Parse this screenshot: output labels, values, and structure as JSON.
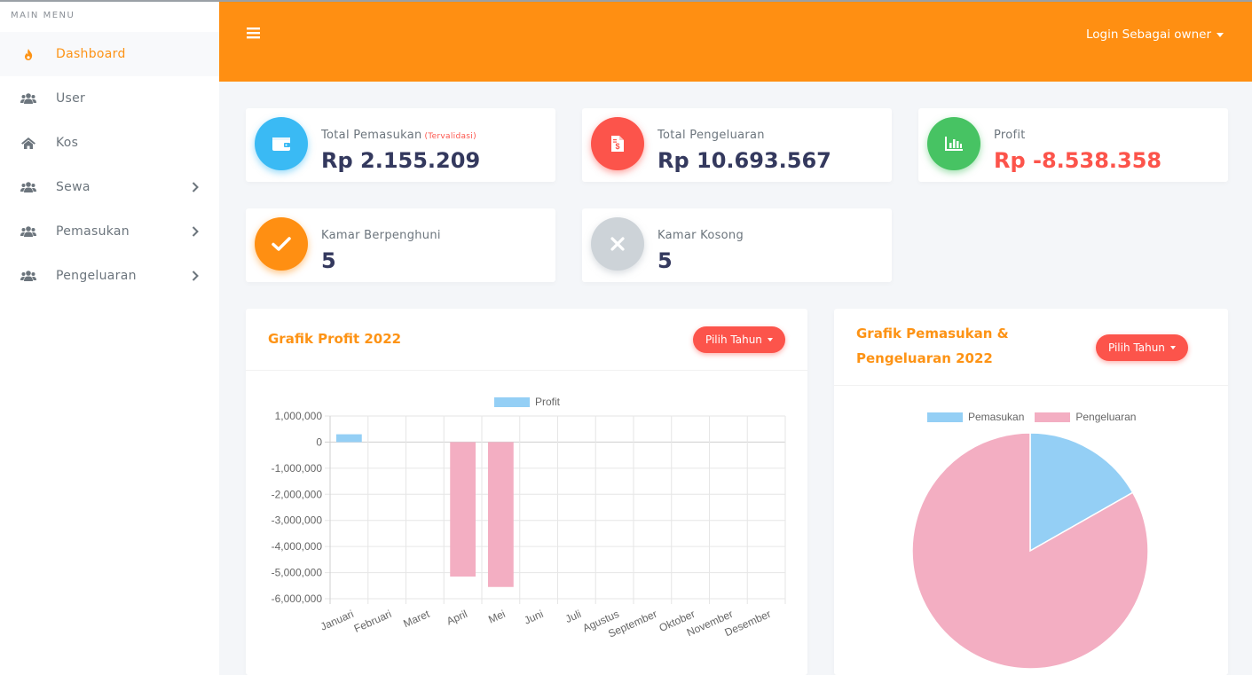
{
  "sidebar": {
    "header": "MAIN MENU",
    "items": [
      {
        "label": "Dashboard",
        "icon": "fire-icon",
        "active": true,
        "submenu": false
      },
      {
        "label": "User",
        "icon": "users-icon",
        "active": false,
        "submenu": false
      },
      {
        "label": "Kos",
        "icon": "home-icon",
        "active": false,
        "submenu": false
      },
      {
        "label": "Sewa",
        "icon": "users-icon",
        "active": false,
        "submenu": true
      },
      {
        "label": "Pemasukan",
        "icon": "users-icon",
        "active": false,
        "submenu": true
      },
      {
        "label": "Pengeluaran",
        "icon": "users-icon",
        "active": false,
        "submenu": true
      }
    ]
  },
  "navbar": {
    "menu_icon": "hamburger-icon",
    "login_label": "Login Sebagai owner"
  },
  "stats": {
    "pemasukan": {
      "title": "Total Pemasukan",
      "note": "(Tervalidasi)",
      "value": "Rp 2.155.209",
      "icon": "wallet-icon",
      "color": "#3abaf4"
    },
    "pengeluaran": {
      "title": "Total Pengeluaran",
      "value": "Rp 10.693.567",
      "icon": "invoice-icon",
      "color": "#fc544b"
    },
    "profit": {
      "title": "Profit",
      "value": "Rp -8.538.358",
      "icon": "bar-chart-icon",
      "color": "#47c363"
    },
    "berpenghuni": {
      "title": "Kamar Berpenghuni",
      "value": "5",
      "icon": "check-icon",
      "color": "#ff8f12"
    },
    "kosong": {
      "title": "Kamar Kosong",
      "value": "5",
      "icon": "times-icon",
      "color": "#cdd3d8"
    }
  },
  "profit_chart": {
    "title": "Grafik Profit 2022",
    "button_label": "Pilih Tahun"
  },
  "pie_chart": {
    "title_line1": "Grafik Pemasukan &",
    "title_line2": "Pengeluaran 2022",
    "button_label": "Pilih Tahun"
  },
  "chart_data": [
    {
      "type": "bar",
      "title": "Grafik Profit 2022",
      "categories": [
        "Januari",
        "Februari",
        "Maret",
        "April",
        "Mei",
        "Juni",
        "Juli",
        "Agustus",
        "September",
        "Oktober",
        "November",
        "Desember"
      ],
      "series": [
        {
          "name": "Profit",
          "values": [
            300000,
            0,
            0,
            -5150000,
            -5550000,
            0,
            0,
            0,
            0,
            0,
            0,
            0
          ]
        }
      ],
      "yticks": [
        "1,000,000",
        "0",
        "-1,000,000",
        "-2,000,000",
        "-3,000,000",
        "-4,000,000",
        "-5,000,000",
        "-6,000,000"
      ],
      "ylim": [
        -6000000,
        1000000
      ],
      "positive_color": "#94cff5",
      "negative_color": "#f3aec2",
      "legend": "top",
      "grid": true
    },
    {
      "type": "pie",
      "title": "Grafik Pemasukan & Pengeluaran 2022",
      "labels": [
        "Pemasukan",
        "Pengeluaran"
      ],
      "values": [
        2155209,
        10693567
      ],
      "colors": [
        "#94cff5",
        "#f3aec2"
      ],
      "legend": "top"
    }
  ]
}
